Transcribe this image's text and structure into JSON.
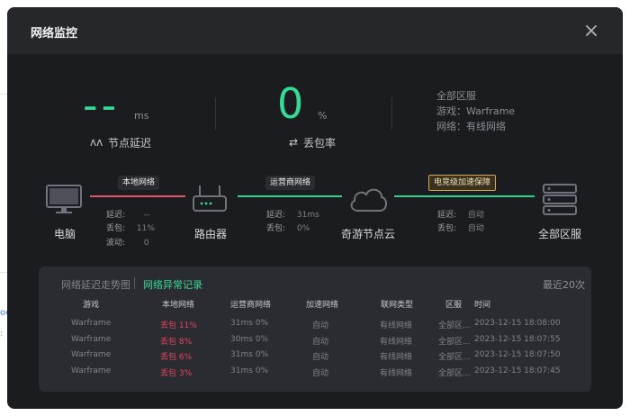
{
  "background": {
    "link_fragment": "oc",
    "text_fragment": ":"
  },
  "dialog": {
    "title": "网络监控",
    "close_label": "×"
  },
  "stats": {
    "latency": {
      "value": "--",
      "unit": "ms",
      "label": "节点延迟",
      "icon_glyph": "ʌʌ"
    },
    "loss": {
      "value": "0",
      "unit": "%",
      "label": "丢包率",
      "icon_glyph": "⇄"
    },
    "region": {
      "name": "全部区服",
      "game": "游戏：Warframe",
      "network": "网络：有线网络"
    }
  },
  "path": {
    "nodes": {
      "pc": "电脑",
      "router": "路由器",
      "cloud": "奇游节点云",
      "server": "全部区服"
    },
    "segments": {
      "local": {
        "title": "本地网络",
        "color": "#e0556a",
        "latency_label": "延迟:",
        "latency_value": "--",
        "loss_label": "丢包:",
        "loss_value": "11%",
        "jitter_label": "波动:",
        "jitter_value": "0"
      },
      "isp": {
        "title": "运营商网络",
        "color": "#2fd08d",
        "latency_label": "延迟:",
        "latency_value": "31ms",
        "loss_label": "丢包:",
        "loss_value": "0%"
      },
      "esports": {
        "title": "电竞级加速保障",
        "color": "#2fd08d",
        "latency_label": "延迟:",
        "latency_value": "自动",
        "loss_label": "丢包:",
        "loss_value": "自动"
      }
    }
  },
  "records": {
    "tabs": [
      {
        "label": "网络延迟走势图",
        "active": false
      },
      {
        "label": "网络异常记录",
        "active": true
      }
    ],
    "recent": "最近20次",
    "columns": [
      "游戏",
      "本地网络",
      "运营商网络",
      "加速网络",
      "联网类型",
      "区服",
      "时间"
    ],
    "rows": [
      [
        "Warframe",
        "丢包 11%",
        "31ms 0%",
        "自动",
        "有线网络",
        "全部区...",
        "2023-12-15 18:08:00"
      ],
      [
        "Warframe",
        "丢包 8%",
        "30ms 0%",
        "自动",
        "有线网络",
        "全部区...",
        "2023-12-15 18:07:55"
      ],
      [
        "Warframe",
        "丢包 6%",
        "31ms 0%",
        "自动",
        "有线网络",
        "全部区...",
        "2023-12-15 18:07:50"
      ],
      [
        "Warframe",
        "丢包 3%",
        "31ms 0%",
        "自动",
        "有线网络",
        "全部区...",
        "2023-12-15 18:07:45"
      ]
    ]
  },
  "colors": {
    "accent_green": "#36d996",
    "loss_red": "#e2455f",
    "gold_badge": "#d5a84a"
  }
}
